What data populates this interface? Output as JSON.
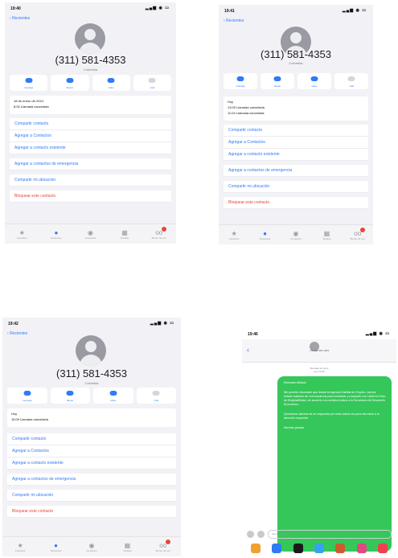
{
  "shots": [
    {
      "status_time": "19:40",
      "back_label": "Recientes",
      "phone": "(311) 581-4353",
      "sub": "Colombia",
      "actions": [
        "mensaje",
        "llamar",
        "video",
        "mail"
      ],
      "log_date": "18 de enero de 2024",
      "log_lines": [
        "8:00 Llamada cancelada"
      ],
      "options": [
        "Compartir contacto",
        "Agregar a Contactos",
        "Agregar a contacto existente",
        "Agregar a contactos de emergencia",
        "Compartir mi ubicación",
        "Bloquear este contacto"
      ]
    },
    {
      "status_time": "19:41",
      "back_label": "Recientes",
      "phone": "(311) 581-4353",
      "sub": "Colombia",
      "actions": [
        "mensaje",
        "llamar",
        "video",
        "mail"
      ],
      "log_date": "Hoy",
      "log_lines": [
        "13:00 Llamada cancelada",
        "11:04 Llamada cancelada"
      ],
      "options": [
        "Compartir contacto",
        "Agregar a Contactos",
        "Agregar a contacto existente",
        "Agregar a contactos de emergencia",
        "Compartir mi ubicación",
        "Bloquear este contacto"
      ]
    },
    {
      "status_time": "19:42",
      "back_label": "Recientes",
      "phone": "(311) 581-4353",
      "sub": "Colombia",
      "actions": [
        "mensaje",
        "llamar",
        "video",
        "mail"
      ],
      "log_date": "Hoy",
      "log_lines": [
        "15:09 Llamada cancelada"
      ],
      "options": [
        "Compartir contacto",
        "Agregar a Contactos",
        "Agregar a contacto existente",
        "Agregar a contactos de emergencia",
        "Compartir mi ubicación",
        "Bloquear este contacto"
      ]
    }
  ],
  "tabs": [
    "Favoritos",
    "Recientes",
    "Contactos",
    "Teclado",
    "Buzón de voz"
  ],
  "message": {
    "status_time": "19:46",
    "sender": "+57 311 581 4353",
    "timestamp_lines": [
      "Mensaje de texto",
      "Hoy 19:46"
    ],
    "paragraphs": [
      "Estimado Afiliado",
      "Me permito informarle que desde la Agencia Distrital de Empleo, hemos estado tratando de comunicarnos para socializar y compartir con Usted la Ruta de Empleabilidad, de acuerdo a la solicitud radica a la Secretaría de Desarrollo Económico.",
      "Quedamos atentos de su respuesta por esta misma vía para dar inicio a la atención requerida.",
      "Muchas gracias"
    ],
    "input_placeholder": "Mensaje de texto"
  },
  "colors": {
    "accent": "#2f7bf6",
    "danger": "#e5483b",
    "bubble": "#35c759"
  }
}
